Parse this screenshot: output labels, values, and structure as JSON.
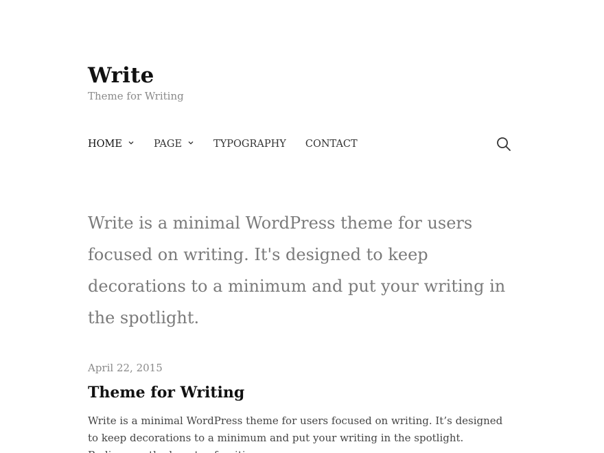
{
  "site": {
    "title": "Write",
    "tagline": "Theme for Writing"
  },
  "nav": {
    "items": [
      {
        "label": "HOME",
        "has_dropdown": true,
        "active": true
      },
      {
        "label": "PAGE",
        "has_dropdown": true,
        "active": false
      },
      {
        "label": "TYPOGRAPHY",
        "has_dropdown": false,
        "active": false
      },
      {
        "label": "CONTACT",
        "has_dropdown": false,
        "active": false
      }
    ],
    "search_icon": "search-icon",
    "dropdown_icon": "chevron-down-icon"
  },
  "intro": {
    "text": "Write is a minimal WordPress theme for users focused on writing. It's designed to keep decorations to a minimum and put your writing in the spotlight."
  },
  "post": {
    "date": "April 22, 2015",
    "title": "Theme for Writing",
    "excerpt": "Write is a minimal WordPress theme for users focused on writing. It’s designed to keep decorations to a minimum and put your writing in the spotlight. Rediscover the beauty of writing."
  },
  "colors": {
    "background": "#ffffff",
    "title": "#111111",
    "muted": "#8a8a8a",
    "intro": "#7a7a7a",
    "body": "#444444"
  }
}
